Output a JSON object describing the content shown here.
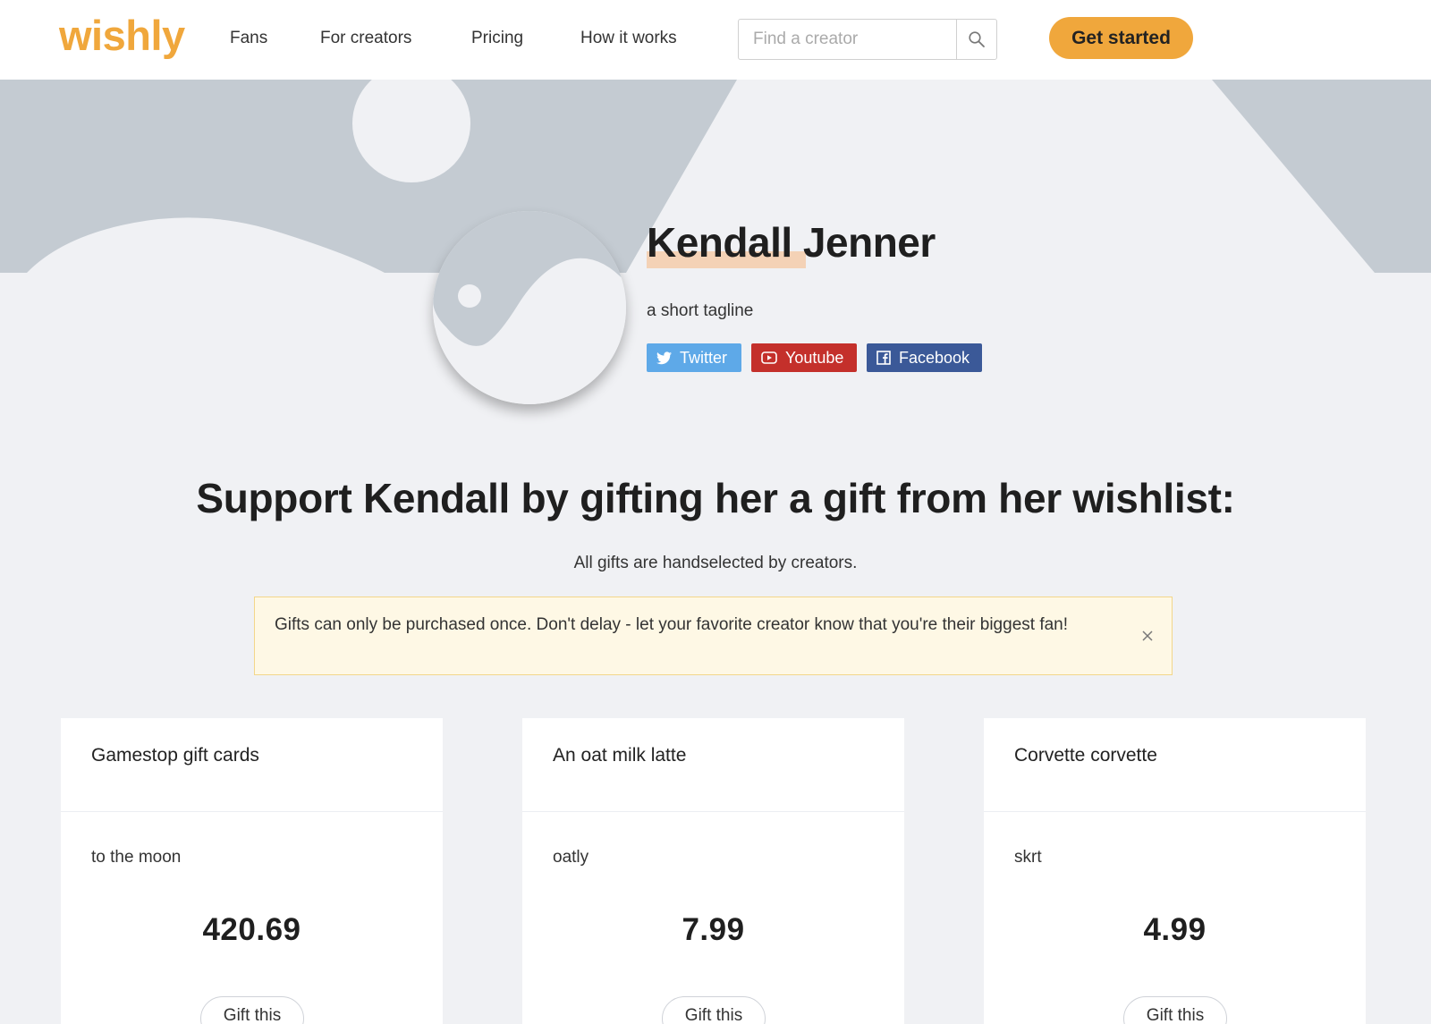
{
  "nav": {
    "logo": "wishly",
    "links": [
      "Fans",
      "For creators",
      "Pricing",
      "How it works"
    ],
    "search_placeholder": "Find a creator",
    "cta_label": "Get started"
  },
  "profile": {
    "name": "Kendall Jenner",
    "tagline": "a short tagline",
    "socials": [
      {
        "label": "Twitter",
        "icon": "twitter-icon",
        "color": "#5ea9e8"
      },
      {
        "label": "Youtube",
        "icon": "youtube-icon",
        "color": "#c4302b"
      },
      {
        "label": "Facebook",
        "icon": "facebook-icon",
        "color": "#3b5998"
      }
    ]
  },
  "wishlist": {
    "headline": "Support Kendall by gifting her a gift from her wishlist:",
    "subtext": "All gifts are handselected by creators.",
    "notice": "Gifts can only be purchased once. Don't delay - let your favorite creator know that you're their biggest fan!",
    "items": [
      {
        "title": "Gamestop gift cards",
        "description": "to the moon",
        "price": "420.69",
        "button": "Gift this"
      },
      {
        "title": "An oat milk latte",
        "description": "oatly",
        "price": "7.99",
        "button": "Gift this"
      },
      {
        "title": "Corvette corvette",
        "description": "skrt",
        "price": "4.99",
        "button": "Gift this"
      }
    ]
  },
  "colors": {
    "brand": "#f0a73c",
    "background": "#f0f1f4",
    "notice_bg": "#fef8e5"
  }
}
